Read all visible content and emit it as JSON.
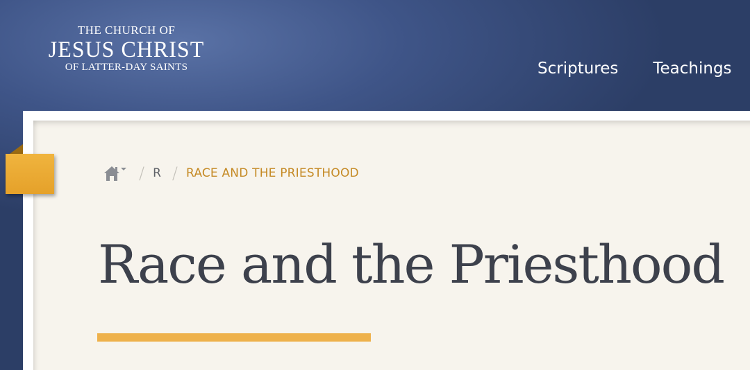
{
  "header": {
    "logo": {
      "line1": "The Church of",
      "line2": "Jesus Christ",
      "line3": "of Latter-day Saints"
    },
    "nav": [
      {
        "label": "Scriptures"
      },
      {
        "label": "Teachings"
      }
    ]
  },
  "breadcrumb": {
    "home_icon": "home-icon",
    "items": [
      {
        "label": "R"
      },
      {
        "label": "Race and the Priesthood"
      }
    ]
  },
  "main": {
    "title": "Race and the Priesthood"
  },
  "colors": {
    "header_blue": "#3f5588",
    "accent_gold": "#eeb14b",
    "breadcrumb_current": "#c58a25",
    "title_text": "#3d414c",
    "content_bg": "#f7f4ed"
  }
}
